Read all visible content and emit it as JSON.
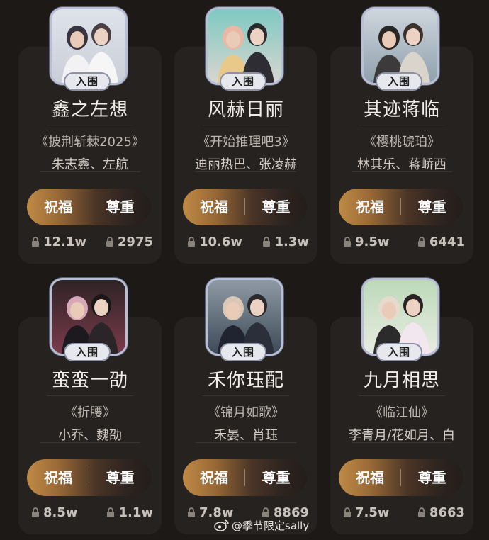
{
  "badge_label": "入围",
  "buttons": {
    "bless": "祝福",
    "respect": "尊重"
  },
  "cards": [
    {
      "cp": "鑫之左想",
      "work": "《披荆斩棘2025》",
      "actors": "朱志鑫、左航",
      "bless_count": "12.1w",
      "respect_count": "2975",
      "poster_icon": "poster-two-men-white-suits"
    },
    {
      "cp": "风赫日丽",
      "work": "《开始推理吧3》",
      "actors": "迪丽热巴、张凌赫",
      "bless_count": "10.6w",
      "respect_count": "1.3w",
      "poster_icon": "poster-woman-blonde-man"
    },
    {
      "cp": "其迹蒋临",
      "work": "《樱桃琥珀》",
      "actors": "林其乐、蒋峤西",
      "bless_count": "9.5w",
      "respect_count": "6441",
      "poster_icon": "poster-couple-in-car"
    },
    {
      "cp": "蛮蛮一劭",
      "work": "《折腰》",
      "actors": "小乔、魏劭",
      "bless_count": "8.5w",
      "respect_count": "1.1w",
      "poster_icon": "poster-costume-couple-dark"
    },
    {
      "cp": "禾你珏配",
      "work": "《锦月如歌》",
      "actors": "禾晏、肖珏",
      "bless_count": "7.8w",
      "respect_count": "8869",
      "poster_icon": "poster-costume-couple-street"
    },
    {
      "cp": "九月相思",
      "work": "《临江仙》",
      "actors": "李青月/花如月、白",
      "bless_count": "7.5w",
      "respect_count": "8663",
      "poster_icon": "poster-costume-couple-green"
    }
  ],
  "watermark": "@季节限定sally"
}
